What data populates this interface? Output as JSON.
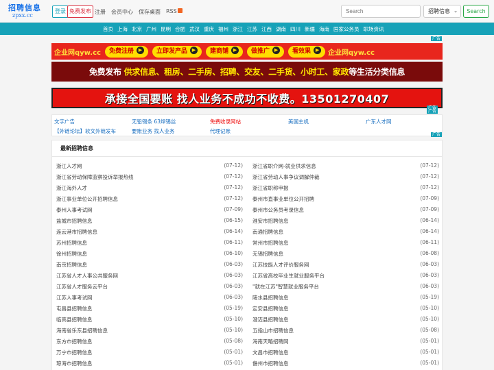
{
  "header": {
    "logo_main": "招聘信息",
    "logo_sub": "zpxx.cc",
    "login_label": "登录",
    "post_free_label": "免费发布",
    "register_label": "注册",
    "member_center_label": "会员中心",
    "save_desktop_label": "保存桌面",
    "rss_label": "RSS",
    "search_placeholder": "Search",
    "category_selected": "招聘信息",
    "search_button": "Search"
  },
  "nav": {
    "items": [
      "首页",
      "上海",
      "北京",
      "广州",
      "昆明",
      "合肥",
      "武汉",
      "重庆",
      "福州",
      "浙江",
      "江苏",
      "江西",
      "湖南",
      "四川",
      "新疆",
      "海南",
      "国家公务员",
      "职场资讯"
    ]
  },
  "ad_label": "广告",
  "banner1": {
    "brand": "企业网qyw.cc",
    "pills": [
      "免费注册",
      "立即发产品",
      "建商铺",
      "做推广",
      "看效果"
    ],
    "brand_end": "企业网qyw.cc"
  },
  "banner2": {
    "prefix": "免费发布 ",
    "highlight": "供求信息、租房、二手房、招聘、交友、二手货、小时工、家政",
    "suffix": "等生活分类信息"
  },
  "banner3": {
    "text": "承接全国要账 找人业务不成功不收费。13501270407"
  },
  "text_links": {
    "row1": [
      "文字广告",
      "无铅锡条 63焊锡丝",
      "免费收录网站",
      "美国主机",
      "广东人才网"
    ],
    "row2": [
      "【外链论坛】软文外链发布",
      "要账业务 找人业务",
      "代理记账"
    ]
  },
  "main": {
    "title": "最新招聘信息",
    "left": [
      {
        "t": "浙江人才网",
        "d": "(07-12)"
      },
      {
        "t": "浙江省劳动保障监察投诉举报热线",
        "d": "(07-12)"
      },
      {
        "t": "浙江海外人才",
        "d": "(07-12)"
      },
      {
        "t": "浙江事业单位公开招聘信息",
        "d": "(07-12)"
      },
      {
        "t": "泰州人事考试网",
        "d": "(07-09)"
      },
      {
        "t": "盐城市招聘信息",
        "d": "(06-15)"
      },
      {
        "t": "连云港市招聘信息",
        "d": "(06-14)"
      },
      {
        "t": "苏州招聘信息",
        "d": "(06-11)"
      },
      {
        "t": "徐州招聘信息",
        "d": "(06-10)"
      },
      {
        "t": "南京招聘信息",
        "d": "(06-03)"
      },
      {
        "t": "江苏省人才人事公共服务网",
        "d": "(06-03)"
      },
      {
        "t": "江苏省人才服务云平台",
        "d": "(06-03)"
      },
      {
        "t": "江苏人事考试网",
        "d": "(06-03)"
      },
      {
        "t": "屯昌县招聘信息",
        "d": "(05-19)"
      },
      {
        "t": "临高县招聘信息",
        "d": "(05-10)"
      },
      {
        "t": "海南省乐东县招聘信息",
        "d": "(05-10)"
      },
      {
        "t": "东方市招聘信息",
        "d": "(05-08)"
      },
      {
        "t": "万宁市招聘信息",
        "d": "(05-01)"
      },
      {
        "t": "琼海市招聘信息",
        "d": "(05-01)"
      }
    ],
    "right": [
      {
        "t": "浙江省职介网-就业供求信息",
        "d": "(07-12)"
      },
      {
        "t": "浙江省劳动人事争议调解仲裁",
        "d": "(07-12)"
      },
      {
        "t": "浙江省职称申报",
        "d": "(07-12)"
      },
      {
        "t": "泰州市直事业单位公开招聘",
        "d": "(07-09)"
      },
      {
        "t": "泰州市公务员考录信息",
        "d": "(07-09)"
      },
      {
        "t": "淮安市招聘信息",
        "d": "(06-14)"
      },
      {
        "t": "南通招聘信息",
        "d": "(06-14)"
      },
      {
        "t": "常州市招聘信息",
        "d": "(06-11)"
      },
      {
        "t": "无锡招聘信息",
        "d": "(06-08)"
      },
      {
        "t": "江苏技能人才评价服务网",
        "d": "(06-03)"
      },
      {
        "t": "江苏省高校毕业生就业服务平台",
        "d": "(06-03)"
      },
      {
        "t": "\"就在江苏\"智慧就业服务平台",
        "d": "(06-03)"
      },
      {
        "t": "陵水县招聘信息",
        "d": "(05-19)"
      },
      {
        "t": "定安县招聘信息",
        "d": "(05-10)"
      },
      {
        "t": "澄迈县招聘信息",
        "d": "(05-10)"
      },
      {
        "t": "五指山市招聘信息",
        "d": "(05-08)"
      },
      {
        "t": "海南天略招聘网",
        "d": "(05-01)"
      },
      {
        "t": "文昌市招聘信息",
        "d": "(05-01)"
      },
      {
        "t": "儋州市招聘信息",
        "d": "(05-01)"
      }
    ]
  }
}
